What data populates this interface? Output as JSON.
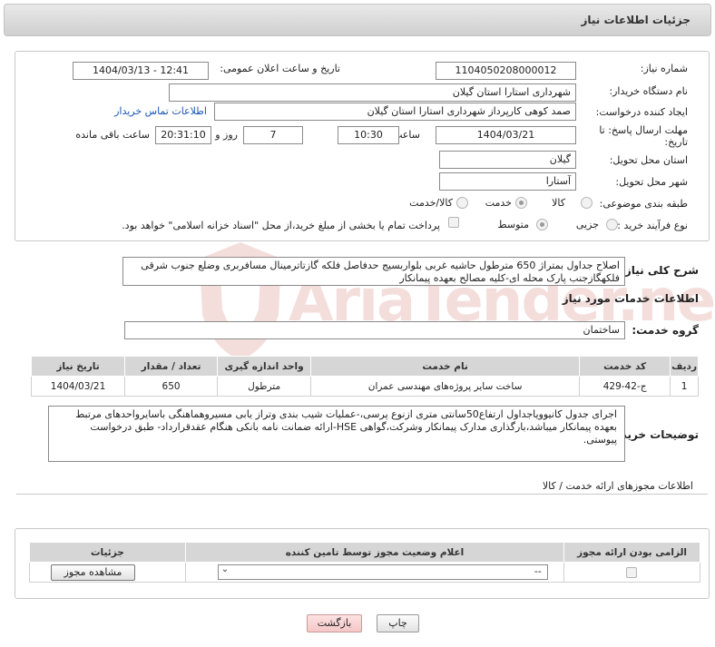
{
  "header": {
    "title": "جزئیات اطلاعات نیاز"
  },
  "form": {
    "need_number": {
      "label": "شماره نیاز:",
      "value": "1104050208000012"
    },
    "announce_date": {
      "label": "تاریخ و ساعت اعلان عمومی:",
      "value": "1404/03/13 - 12:41"
    },
    "buyer_org": {
      "label": "نام دستگاه خریدار:",
      "value": "شهرداری استارا استان گیلان"
    },
    "requester": {
      "label": "ایجاد کننده درخواست:",
      "value": "صمد کوهی کارپرداز شهرداری استارا استان گیلان",
      "contact_link": "اطلاعات تماس خریدار"
    },
    "deadline": {
      "label_line1": "مهلت ارسال پاسخ: تا",
      "label_line2": "تاریخ:",
      "date": "1404/03/21",
      "time_label": "ساعت",
      "time": "10:30",
      "days": "7",
      "days_label": "روز و",
      "remaining": "20:31:10",
      "remaining_label": "ساعت باقی مانده"
    },
    "province": {
      "label": "استان محل تحویل:",
      "value": "گیلان"
    },
    "city": {
      "label": "شهر محل تحویل:",
      "value": "آستارا"
    },
    "category": {
      "label": "طبقه بندی موضوعی:",
      "options": [
        "کالا",
        "خدمت",
        "کالا/خدمت"
      ],
      "selected": "خدمت"
    },
    "process": {
      "label": "نوع فرآیند خرید :",
      "options": [
        "جزیی",
        "متوسط"
      ],
      "selected": "متوسط",
      "payment_note": "پرداخت تمام یا بخشی از مبلغ خرید،از محل \"اسناد خزانه اسلامی\" خواهد بود."
    }
  },
  "summary": {
    "label": "شرح کلی نیاز:",
    "text": "اصلاح جداول بمتراژ 650 مترطول حاشیه غربی بلواربسیج حدفاصل فلکه گازتاترمینال مسافربری وضلع جنوب شرقی فلکهگازجنب پارک محله ای-کلیه مصالح بعهده پیمانکار"
  },
  "services": {
    "section_title": "اطلاعات خدمات مورد نیاز",
    "group_label": "گروه خدمت:",
    "group_value": "ساختمان",
    "columns": [
      "ردیف",
      "کد خدمت",
      "نام خدمت",
      "واحد اندازه گیری",
      "تعداد / مقدار",
      "تاریخ نیاز"
    ],
    "rows": [
      [
        "1",
        "ج-42-429",
        "ساخت سایر پروژه‌های مهندسی عمران",
        "مترطول",
        "650",
        "1404/03/21"
      ]
    ]
  },
  "buyer_notes": {
    "label": "توضیحات خریدار:",
    "text": "اجرای جدول کانیوویاجداول ارتفاع50سانتی متری ازنوع پرسی،-عملیات شیب بندی وتراز یابی مسیروهماهنگی باسایرواحدهای مرتبط بعهده پیمانکار میباشد،بارگذاری مدارک پیمانکار وشرکت،گواهی HSE-ارائه ضمانت نامه بانکی هنگام عقدقرارداد- طبق درخواست پیوستی."
  },
  "permits": {
    "title": "اطلاعات مجوزهای ارائه خدمت / کالا",
    "columns": [
      "الزامی بودن ارائه مجوز",
      "اعلام وضعیت مجوز توسط تامین کننده",
      "جزئیات"
    ],
    "select_value": "--",
    "view_button": "مشاهده مجوز"
  },
  "actions": {
    "print": "چاپ",
    "back": "بازگشت"
  },
  "watermark": {
    "text": "AriaTender.net",
    "color": "#c0392b"
  }
}
